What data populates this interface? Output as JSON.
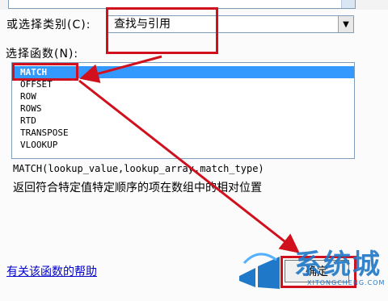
{
  "category": {
    "label": "或选择类别(C):",
    "selected": "查找与引用"
  },
  "function_list": {
    "label": "选择函数(N):",
    "items": [
      "MATCH",
      "OFFSET",
      "ROW",
      "ROWS",
      "RTD",
      "TRANSPOSE",
      "VLOOKUP"
    ],
    "selected": "MATCH"
  },
  "description": {
    "syntax": "MATCH(lookup_value,lookup_array,match_type)",
    "text": "返回符合特定值特定顺序的项在数组中的相对位置"
  },
  "footer": {
    "help_link": "有关该函数的帮助",
    "ok_label": "确定"
  },
  "watermark": {
    "text": "系统城",
    "subtext": "XITONGCHENG.COM"
  },
  "colors": {
    "selection": "#3399ff",
    "annotation": "#d0101c",
    "watermark": "#1f78c8"
  }
}
